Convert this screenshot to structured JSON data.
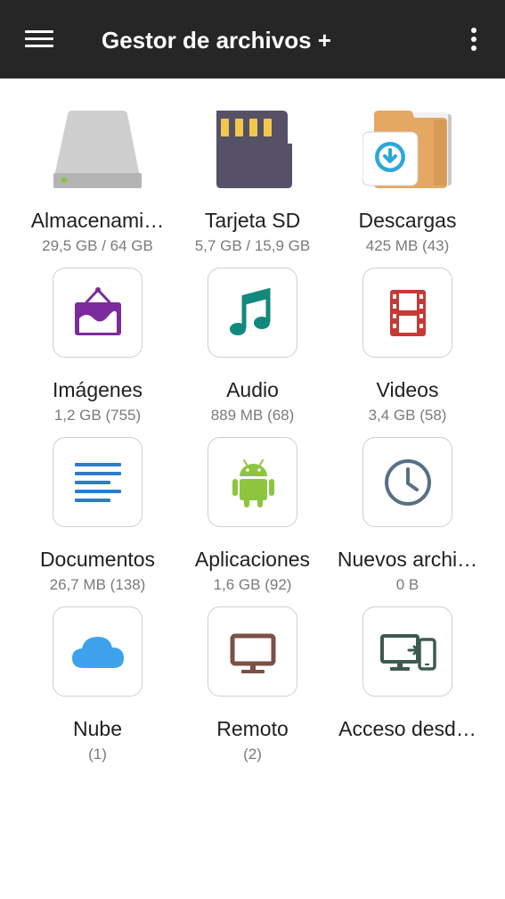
{
  "app_bar": {
    "title": "Gestor de archivos +",
    "menu_icon": "hamburger-menu-icon",
    "overflow_icon": "more-vert-icon"
  },
  "tiles": [
    {
      "label": "Almacenami…",
      "detail": "29,5 GB / 64 GB",
      "icon": "internal-storage-icon"
    },
    {
      "label": "Tarjeta SD",
      "detail": "5,7 GB / 15,9 GB",
      "icon": "sd-card-icon"
    },
    {
      "label": "Descargas",
      "detail": "425 MB (43)",
      "icon": "downloads-folder-icon"
    },
    {
      "label": "Imágenes",
      "detail": "1,2 GB (755)",
      "icon": "picture-frame-icon"
    },
    {
      "label": "Audio",
      "detail": "889 MB (68)",
      "icon": "music-note-icon"
    },
    {
      "label": "Videos",
      "detail": "3,4 GB (58)",
      "icon": "film-strip-icon"
    },
    {
      "label": "Documentos",
      "detail": "26,7 MB (138)",
      "icon": "document-lines-icon"
    },
    {
      "label": "Aplicaciones",
      "detail": "1,6 GB (92)",
      "icon": "android-icon"
    },
    {
      "label": "Nuevos archi…",
      "detail": "0 B",
      "icon": "clock-icon"
    },
    {
      "label": "Nube",
      "detail": "(1)",
      "icon": "cloud-icon"
    },
    {
      "label": "Remoto",
      "detail": "(2)",
      "icon": "monitor-icon"
    },
    {
      "label": "Acceso desd…",
      "detail": "",
      "icon": "device-transfer-icon"
    }
  ],
  "colors": {
    "app_bar": "#262626",
    "storage": "#cfcfcf",
    "sd_card": "#565167",
    "downloads_folder": "#e4a862",
    "downloads_accent": "#2ea7da",
    "images": "#7b2b9b",
    "audio": "#12897c",
    "videos": "#c53a36",
    "documents": "#2e7bd0",
    "apps": "#8dc53e",
    "recent": "#5a6f86",
    "cloud": "#3fa2ec",
    "remote": "#7b5045",
    "device_access": "#3e5a4e"
  }
}
